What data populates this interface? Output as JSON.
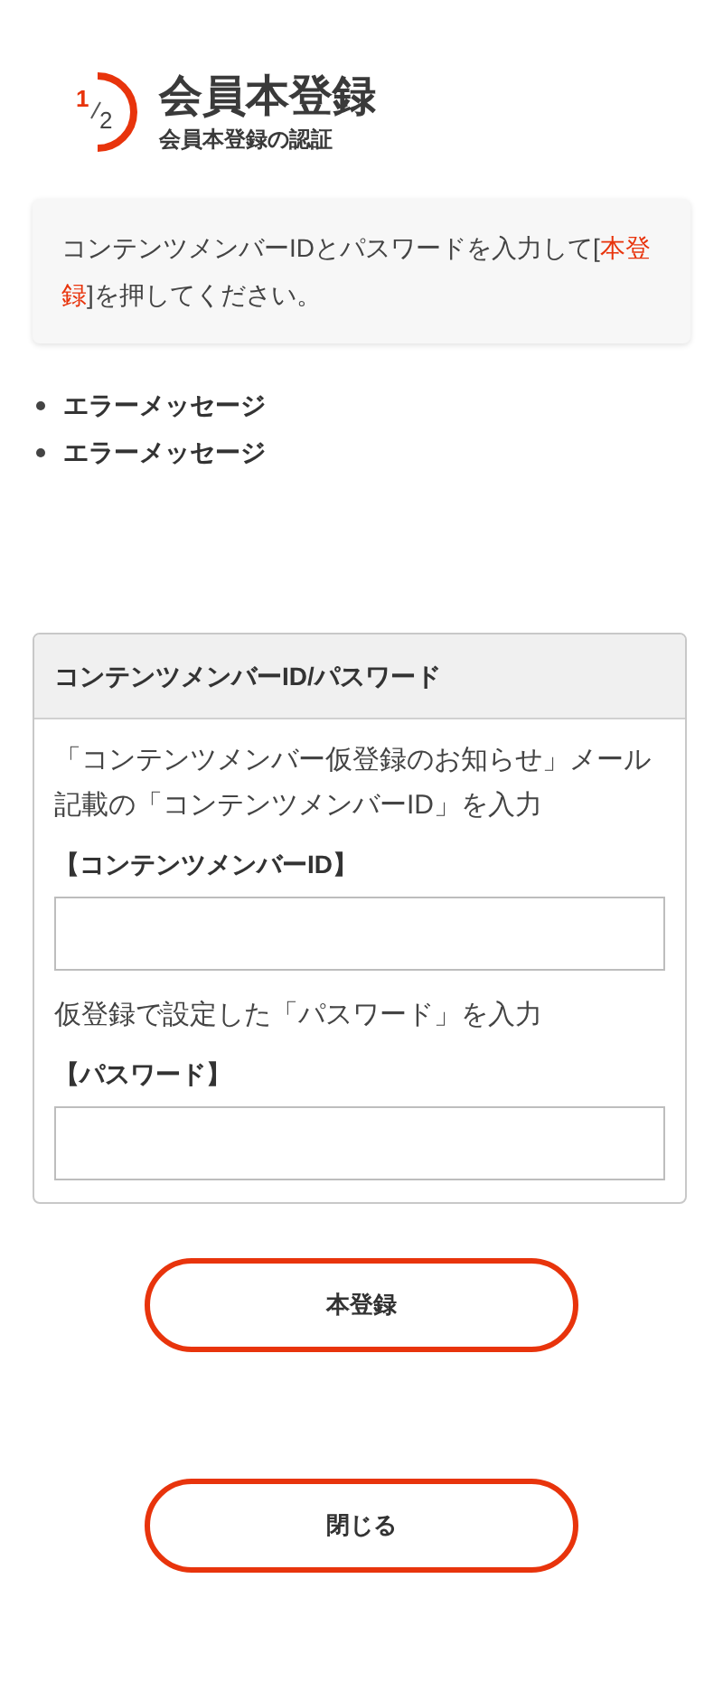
{
  "step": {
    "current": "1",
    "total": "2"
  },
  "title": "会員本登録",
  "subtitle": "会員本登録の認証",
  "notice": [
    {
      "kind": "plain",
      "text": "コンテンツメンバーIDとパスワードを入力して["
    },
    {
      "kind": "emphasis",
      "text": "本登録"
    },
    {
      "kind": "plain",
      "text": "]を押してください。"
    }
  ],
  "errors": [
    "エラーメッセージ",
    "エラーメッセージ"
  ],
  "panel": {
    "title": "コンテンツメンバーID/パスワード",
    "fields": [
      {
        "hint": "「コンテンツメンバー仮登録のお知らせ」メール記載の「コンテンツメンバーID」を入力",
        "label": "【コンテンツメンバーID】"
      },
      {
        "hint": "仮登録で設定した「パスワード」を入力",
        "label": "【パスワード】"
      }
    ]
  },
  "buttons": [
    "本登録",
    "閉じる"
  ]
}
